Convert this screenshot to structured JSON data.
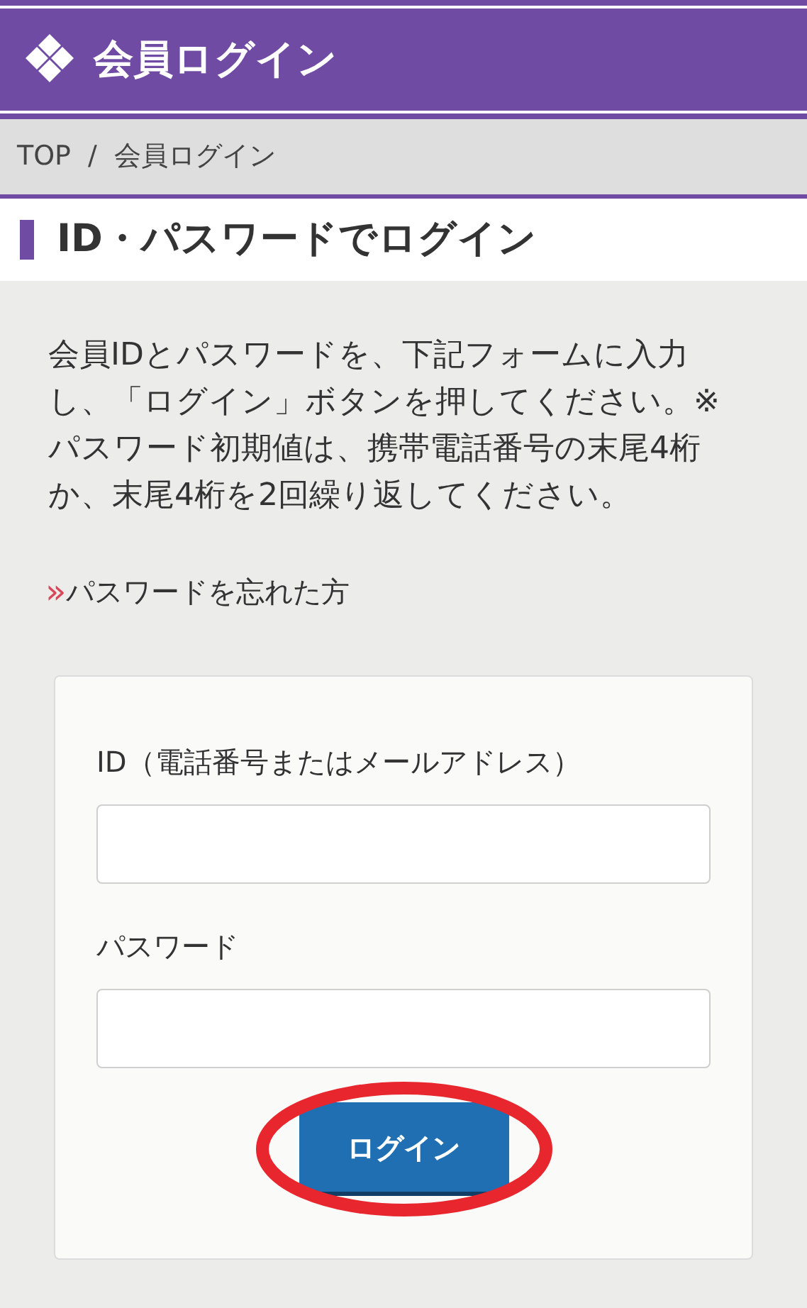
{
  "header": {
    "title": "会員ログイン"
  },
  "breadcrumb": [
    "TOP",
    "/",
    "会員ログイン"
  ],
  "section_title": "ID・パスワードでログイン",
  "intro": "会員IDとパスワードを、下記フォームに入力し、「ログイン」ボタンを押してください。※パスワード初期値は、携帯電話番号の末尾4桁か、末尾4桁を2回繰り返してください。",
  "forgot_link": {
    "marker": "»",
    "label": "パスワードを忘れた方"
  },
  "form": {
    "fields": [
      {
        "label": "ID（電話番号またはメールアドレス）"
      },
      {
        "label": "パスワード"
      }
    ],
    "submit": {
      "label": "ログイン",
      "highlighted": true
    }
  }
}
